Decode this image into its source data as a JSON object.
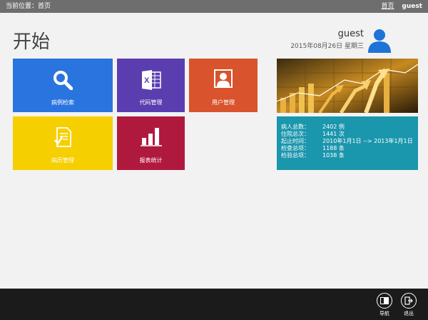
{
  "topbar": {
    "breadcrumb": "当前位置：首页",
    "home_link": "首页",
    "username": "guest"
  },
  "header": {
    "title": "开始",
    "user_name": "guest",
    "date": "2015年08月26日 星期三"
  },
  "tiles": {
    "search": "病例检索",
    "code": "代码管理",
    "user": "用户管理",
    "record": "病历管理",
    "report": "报表统计"
  },
  "stats": [
    {
      "label": "病人总数：",
      "value": "2402 例"
    },
    {
      "label": "住院总次：",
      "value": "1441 次"
    },
    {
      "label": "起止时间：",
      "value": "2010年1月1日 --> 2013年1月1日"
    },
    {
      "label": "检查总项：",
      "value": "1188 条"
    },
    {
      "label": "检验总项：",
      "value": "1038 条"
    }
  ],
  "bottombar": {
    "nav_label": "导航",
    "exit_label": "退出"
  },
  "colors": {
    "search_tile": "#2a74df",
    "code_tile": "#5a3eb0",
    "user_tile": "#d9532c",
    "record_tile": "#f5cf00",
    "report_tile": "#b0193e",
    "stats_panel": "#1a96ad",
    "avatar": "#1e73d6"
  },
  "icons": {
    "search": "magnifier-icon",
    "code": "excel-icon",
    "user": "portrait-icon",
    "record": "document-check-icon",
    "report": "bar-chart-icon",
    "avatar": "person-icon",
    "nav": "book-icon",
    "exit": "exit-icon"
  }
}
